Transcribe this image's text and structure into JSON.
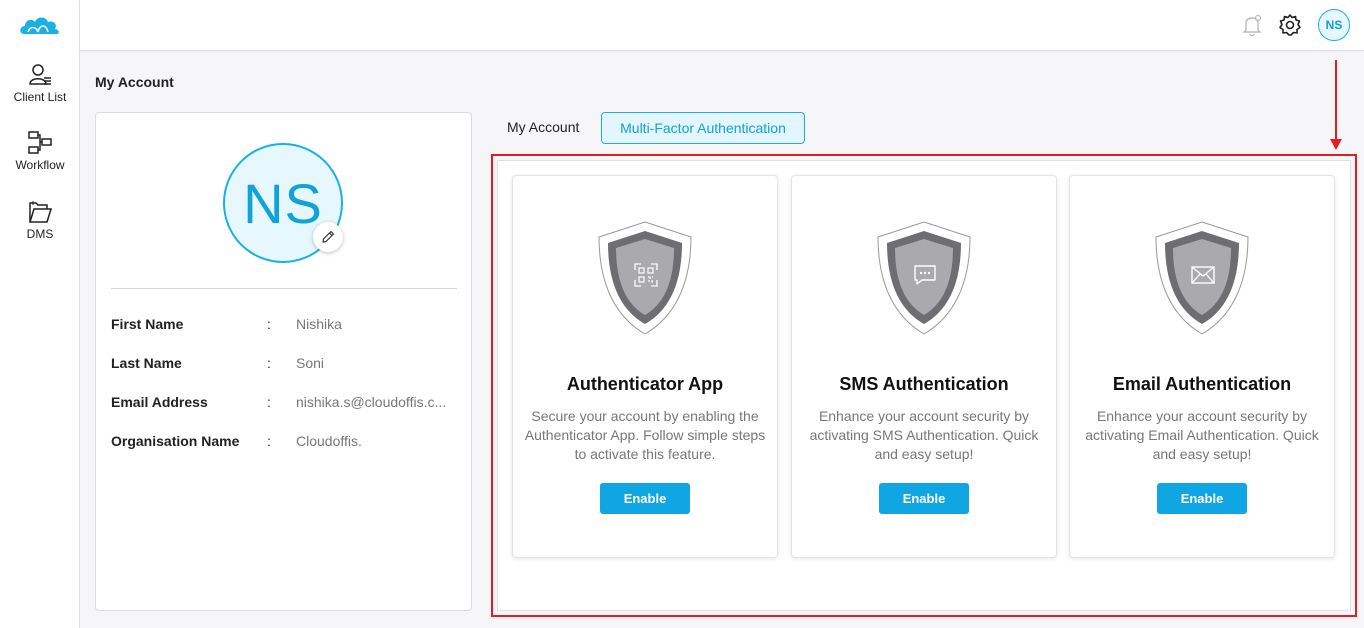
{
  "sidebar": {
    "items": [
      {
        "label": "Client List",
        "icon": "client-list-icon"
      },
      {
        "label": "Workflow",
        "icon": "workflow-icon"
      },
      {
        "label": "DMS",
        "icon": "folder-icon"
      }
    ]
  },
  "header": {
    "avatar_initials": "NS"
  },
  "page": {
    "title": "My Account"
  },
  "profile": {
    "avatar_initials": "NS",
    "fields": [
      {
        "label": "First Name",
        "colon": ":",
        "value": "Nishika"
      },
      {
        "label": "Last Name",
        "colon": ":",
        "value": "Soni"
      },
      {
        "label": "Email Address",
        "colon": ":",
        "value": "nishika.s@cloudoffis.c..."
      },
      {
        "label": "Organisation Name",
        "colon": ":",
        "value": "Cloudoffis."
      }
    ]
  },
  "tabs": [
    {
      "label": "My Account",
      "active": false
    },
    {
      "label": "Multi-Factor Authentication",
      "active": true
    }
  ],
  "mfa_cards": [
    {
      "title": "Authenticator App",
      "description": "Secure your account by enabling the Authenticator App. Follow simple steps to activate this feature.",
      "button": "Enable",
      "icon": "qr-code-icon"
    },
    {
      "title": "SMS Authentication",
      "description": "Enhance your account security by activating SMS Authentication. Quick and easy setup!",
      "button": "Enable",
      "icon": "chat-icon"
    },
    {
      "title": "Email Authentication",
      "description": "Enhance your account security by activating Email Authentication. Quick and easy setup!",
      "button": "Enable",
      "icon": "envelope-icon"
    }
  ],
  "colors": {
    "accent": "#10a6e3",
    "highlight": "#e02020"
  }
}
